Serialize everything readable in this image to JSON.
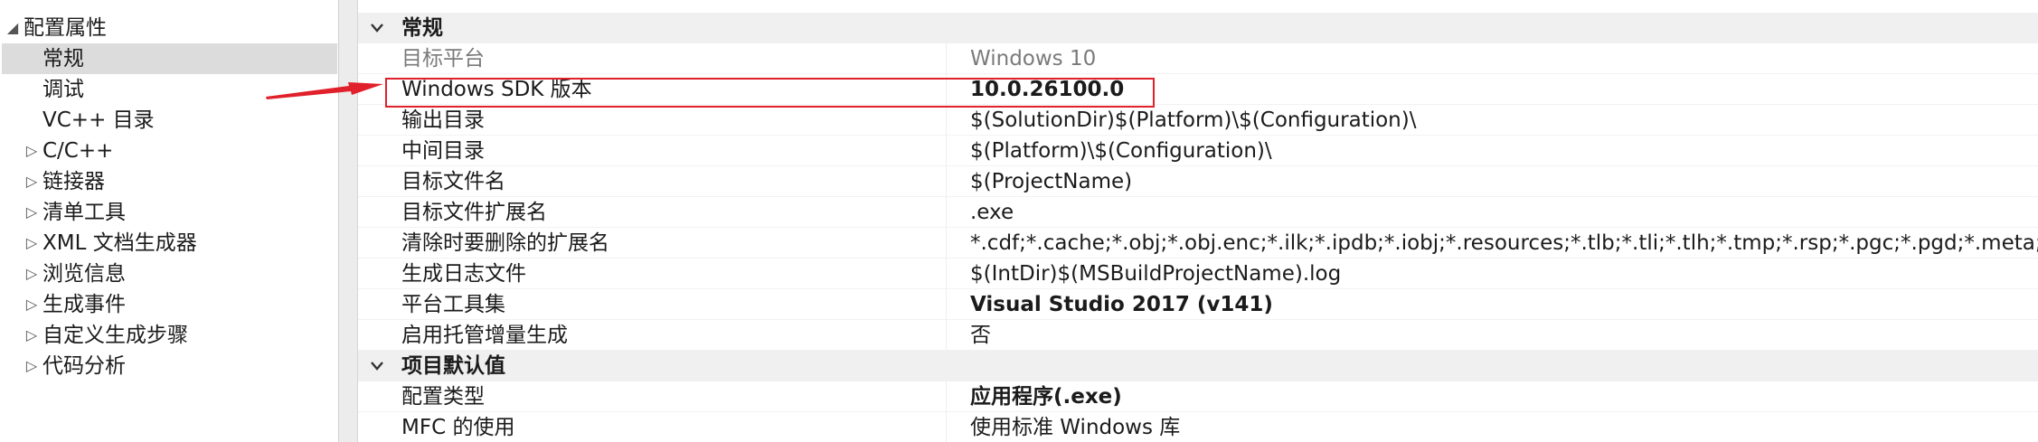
{
  "tree": {
    "items": [
      {
        "label": "配置属性",
        "glyph": "◢"
      },
      {
        "label": "常规",
        "glyph": ""
      },
      {
        "label": "调试",
        "glyph": ""
      },
      {
        "label": "VC++ 目录",
        "glyph": ""
      },
      {
        "label": "C/C++",
        "glyph": "▷"
      },
      {
        "label": "链接器",
        "glyph": "▷"
      },
      {
        "label": "清单工具",
        "glyph": "▷"
      },
      {
        "label": "XML 文档生成器",
        "glyph": "▷"
      },
      {
        "label": "浏览信息",
        "glyph": "▷"
      },
      {
        "label": "生成事件",
        "glyph": "▷"
      },
      {
        "label": "自定义生成步骤",
        "glyph": "▷"
      },
      {
        "label": "代码分析",
        "glyph": "▷"
      }
    ]
  },
  "grid": {
    "categories": [
      {
        "label": "常规"
      },
      {
        "label": "项目默认值"
      }
    ],
    "general_rows": [
      {
        "name": "目标平台",
        "value": "Windows 10"
      },
      {
        "name": "Windows SDK 版本",
        "value": "10.0.26100.0"
      },
      {
        "name": "输出目录",
        "value": "$(SolutionDir)$(Platform)\\$(Configuration)\\"
      },
      {
        "name": "中间目录",
        "value": "$(Platform)\\$(Configuration)\\"
      },
      {
        "name": "目标文件名",
        "value": "$(ProjectName)"
      },
      {
        "name": "目标文件扩展名",
        "value": ".exe"
      },
      {
        "name": "清除时要删除的扩展名",
        "value": "*.cdf;*.cache;*.obj;*.obj.enc;*.ilk;*.ipdb;*.iobj;*.resources;*.tlb;*.tli;*.tlh;*.tmp;*.rsp;*.pgc;*.pgd;*.meta;*.tlog"
      },
      {
        "name": "生成日志文件",
        "value": "$(IntDir)$(MSBuildProjectName).log"
      },
      {
        "name": "平台工具集",
        "value": "Visual Studio 2017 (v141)"
      },
      {
        "name": "启用托管增量生成",
        "value": "否"
      }
    ],
    "defaults_rows": [
      {
        "name": "配置类型",
        "value": "应用程序(.exe)"
      },
      {
        "name": "MFC 的使用",
        "value": "使用标准 Windows 库"
      }
    ]
  },
  "colors": {
    "highlight": "#e0202a",
    "selection": "#dcdcdc",
    "category_bg": "#f0f0f0",
    "disabled_text": "#7a7a7a"
  }
}
